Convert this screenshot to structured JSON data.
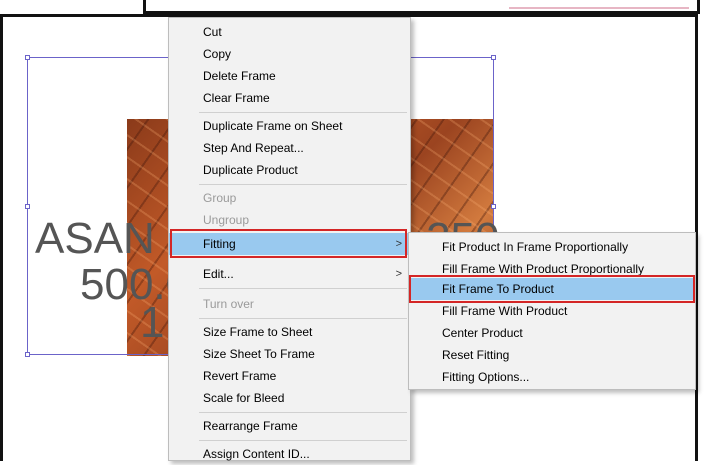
{
  "canvas": {
    "text_line1_left": "ASAN",
    "text_line1_right": "250",
    "text_line2": "500.0",
    "text_line3": "1"
  },
  "context_menu": {
    "items": [
      {
        "label": "Cut",
        "enabled": true
      },
      {
        "label": "Copy",
        "enabled": true
      },
      {
        "label": "Delete Frame",
        "enabled": true
      },
      {
        "label": "Clear Frame",
        "enabled": true
      },
      {
        "label": "Duplicate Frame on Sheet",
        "enabled": true
      },
      {
        "label": "Step And Repeat...",
        "enabled": true
      },
      {
        "label": "Duplicate Product",
        "enabled": true
      },
      {
        "label": "Group",
        "enabled": false
      },
      {
        "label": "Ungroup",
        "enabled": false
      },
      {
        "label": "Fitting",
        "enabled": true,
        "submenu": true,
        "highlighted": true
      },
      {
        "label": "Edit...",
        "enabled": true,
        "submenu": true
      },
      {
        "label": "Turn over",
        "enabled": false
      },
      {
        "label": "Size Frame to Sheet",
        "enabled": true
      },
      {
        "label": "Size Sheet To Frame",
        "enabled": true
      },
      {
        "label": "Revert Frame",
        "enabled": true
      },
      {
        "label": "Scale for Bleed",
        "enabled": true
      },
      {
        "label": "Rearrange Frame",
        "enabled": true
      },
      {
        "label": "Assign Content ID...",
        "enabled": true
      }
    ],
    "submenu_arrow": ">"
  },
  "fitting_submenu": {
    "items": [
      {
        "label": "Fit Product In Frame Proportionally"
      },
      {
        "label": "Fill Frame With Product Proportionally"
      },
      {
        "label": "Fit Frame To Product",
        "highlighted": true
      },
      {
        "label": "Fill Frame With Product"
      },
      {
        "label": "Center Product"
      },
      {
        "label": "Reset Fitting"
      },
      {
        "label": "Fitting Options..."
      }
    ]
  },
  "colors": {
    "highlight": "#99c9ef",
    "callout_red": "#d42626",
    "selection": "#6b63c9"
  }
}
